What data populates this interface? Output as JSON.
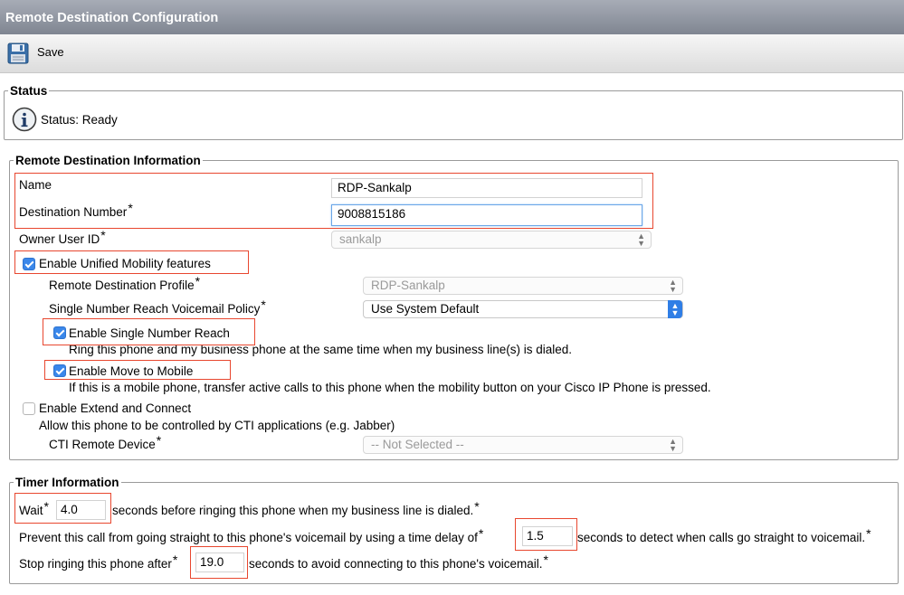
{
  "window": {
    "title": "Remote Destination Configuration"
  },
  "toolbar": {
    "save_label": "Save",
    "save_icon": "floppy-disk-icon"
  },
  "status": {
    "legend": "Status",
    "icon": "info-icon",
    "text": "Status: Ready"
  },
  "rdi": {
    "legend": "Remote Destination Information",
    "name_label": "Name",
    "name_value": "RDP-Sankalp",
    "dest_label": "Destination Number",
    "dest_value": "9008815186",
    "owner_label": "Owner User ID",
    "owner_value": "sankalp",
    "umf_label": "Enable Unified Mobility features",
    "umf_checked": true,
    "rdp_label": "Remote Destination Profile",
    "rdp_value": "RDP-Sankalp",
    "snr_policy_label": "Single Number Reach Voicemail Policy",
    "snr_policy_value": "Use System Default",
    "snr_label": "Enable Single Number Reach",
    "snr_checked": true,
    "snr_desc": "Ring this phone and my business phone at the same time when my business line(s) is dialed.",
    "mtm_label": "Enable Move to Mobile",
    "mtm_checked": true,
    "mtm_desc": "If this is a mobile phone, transfer active calls to this phone when the mobility button on your Cisco IP Phone is pressed.",
    "extend_label": "Enable Extend and Connect",
    "extend_checked": false,
    "extend_desc": "Allow this phone to be controlled by CTI applications (e.g. Jabber)",
    "cti_label": "CTI Remote Device",
    "cti_value": "-- Not Selected --"
  },
  "timer": {
    "legend": "Timer Information",
    "wait_label": "Wait",
    "wait_value": "4.0",
    "wait_suffix": "seconds before ringing this phone when my business line is dialed.",
    "prevent_prefix": "Prevent this call from going straight to this phone's voicemail by using a time delay of",
    "prevent_value": "1.5",
    "prevent_suffix": "seconds to detect when calls go straight to voicemail.",
    "stop_prefix": "Stop ringing this phone after",
    "stop_value": "19.0",
    "stop_suffix": "seconds to avoid connecting to this phone's voicemail."
  },
  "required_mark": "*",
  "colors": {
    "highlight": "#e8472f",
    "accent": "#3a87ea"
  }
}
